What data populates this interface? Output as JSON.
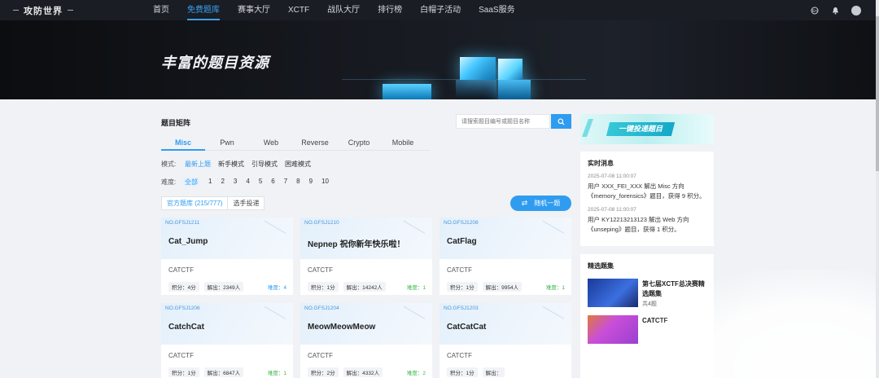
{
  "nav": {
    "logo": "攻防世界",
    "items": [
      "首页",
      "免费题库",
      "赛事大厅",
      "XCTF",
      "战队大厅",
      "排行榜",
      "白帽子活动",
      "SaaS服务"
    ],
    "active_index": 1,
    "icons": [
      "language-icon",
      "bell-icon",
      "avatar"
    ]
  },
  "banner": {
    "title": "丰富的题目资源"
  },
  "main": {
    "section_title": "题目矩阵",
    "search_placeholder": "请搜索题目编号或题目名称",
    "categories": [
      "Misc",
      "Pwn",
      "Web",
      "Reverse",
      "Crypto",
      "Mobile"
    ],
    "active_category": 0,
    "mode_label": "模式:",
    "modes": [
      "最新上题",
      "新手模式",
      "引导模式",
      "困难模式"
    ],
    "active_mode": 0,
    "difficulty_label": "难度:",
    "difficulties": [
      "全部",
      "1",
      "2",
      "3",
      "4",
      "5",
      "6",
      "7",
      "8",
      "9",
      "10"
    ],
    "active_difficulty": 0,
    "tabs": [
      "官方题库 (215/777)",
      "选手投递"
    ],
    "random_button": "随机一题",
    "cards": [
      {
        "no": "NO.GFSJ1211",
        "name": "Cat_Jump",
        "source": "CATCTF",
        "score": "积分：4分",
        "solves": "解出：2349人",
        "difficulty": "难度：4",
        "diff_color": "#2f9cf0"
      },
      {
        "no": "NO.GFSJ1210",
        "name": "Nepnep 祝你新年快乐啦！",
        "source": "CATCTF",
        "score": "积分：1分",
        "solves": "解出：14242人",
        "difficulty": "难度：1",
        "diff_color": "#3ab54a"
      },
      {
        "no": "NO.GFSJ1208",
        "name": "CatFlag",
        "source": "CATCTF",
        "score": "积分：1分",
        "solves": "解出：9954人",
        "difficulty": "难度：1",
        "diff_color": "#3ab54a"
      },
      {
        "no": "NO.GFSJ1206",
        "name": "CatchCat",
        "source": "CATCTF",
        "score": "积分：1分",
        "solves": "解出：6847人",
        "difficulty": "难度：1",
        "diff_color": "#3ab54a"
      },
      {
        "no": "NO.GFSJ1204",
        "name": "MeowMeowMeow",
        "source": "CATCTF",
        "score": "积分：2分",
        "solves": "解出：4332人",
        "difficulty": "难度：2",
        "diff_color": "#3ab54a"
      },
      {
        "no": "NO.GFSJ1203",
        "name": "CatCatCat",
        "source": "CATCTF",
        "score": "积分：1分",
        "solves": "解出：",
        "difficulty": "",
        "diff_color": "#3ab54a"
      }
    ]
  },
  "side": {
    "submit_button": "一键投递题目",
    "news_title": "实时消息",
    "news": [
      {
        "time": "2025-07-08 11:00:07",
        "text": "用户 XXX_FEI_XXX 解出 Misc 方向《memory_forensics》题目，获得 9 积分。"
      },
      {
        "time": "2025-07-08 11:00:07",
        "text": "用户 KY12213213123 解出 Web 方向《unseping》题目，获得 1 积分。"
      }
    ],
    "picks_title": "精选题集",
    "picks": [
      {
        "name": "第七届XCTF总决赛精选题集",
        "count": "共4题",
        "thumb_color": "#2a4fb0"
      },
      {
        "name": "CATCTF",
        "count": "",
        "thumb_color": "#c94fd8"
      }
    ]
  }
}
